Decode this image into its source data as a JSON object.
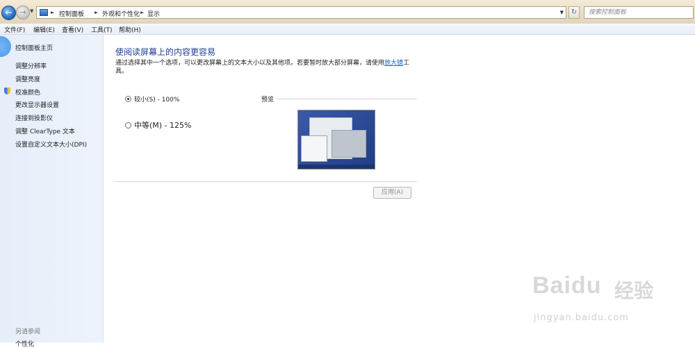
{
  "address_bar": {
    "crumbs": [
      "控制面板",
      "外观和个性化",
      "显示"
    ],
    "search_placeholder": "搜索控制面板"
  },
  "menu": [
    "文件(F)",
    "编辑(E)",
    "查看(V)",
    "工具(T)",
    "帮助(H)"
  ],
  "sidebar": {
    "home": "控制面板主页",
    "items": [
      "调整分辨率",
      "调整亮度",
      "校准颜色",
      "更改显示器设置",
      "连接到投影仪",
      "调整 ClearType 文本",
      "设置自定义文本大小(DPI)"
    ],
    "see_also_title": "另请参阅",
    "see_also_partial": "个性化"
  },
  "main": {
    "title": "使阅读屏幕上的内容更容易",
    "desc_before": "通过选择其中一个选项，可以更改屏幕上的文本大小以及其他项。若要暂时放大部分屏幕，请使用",
    "desc_link": "放大镜",
    "desc_after": "工具。",
    "options": [
      {
        "label": "较小(S) - 100%",
        "selected": true
      },
      {
        "label": "中等(M) - 125%",
        "selected": false
      }
    ],
    "preview_label": "预览",
    "apply_button": "应用(A)"
  },
  "watermark": {
    "brand": "Bai",
    "brand2": "du",
    "cn": "经验",
    "url": "jingyan.baidu.com"
  }
}
